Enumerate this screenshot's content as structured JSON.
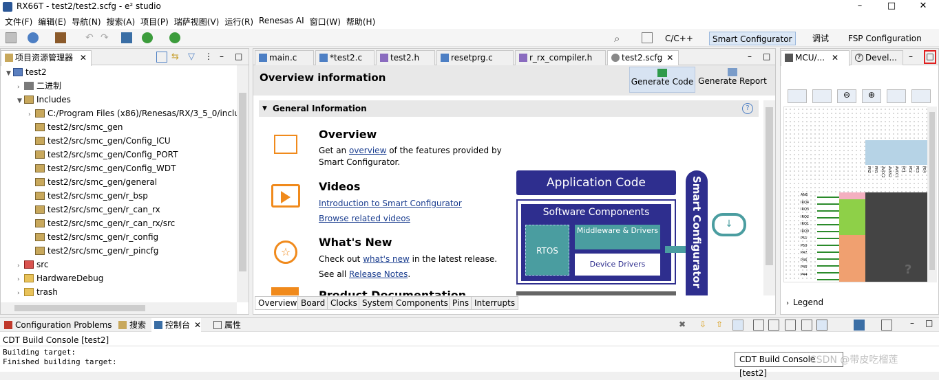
{
  "window": {
    "title": "RX66T - test2/test2.scfg - e² studio",
    "controls": [
      "–",
      "□",
      "✕"
    ]
  },
  "menu": [
    "文件(F)",
    "编辑(E)",
    "导航(N)",
    "搜索(A)",
    "项目(P)",
    "瑞萨视图(V)",
    "运行(R)",
    "Renesas AI",
    "窗口(W)",
    "帮助(H)"
  ],
  "perspectives": [
    "C/C++",
    "Smart Configurator",
    "调试",
    "FSP Configuration"
  ],
  "explorer": {
    "tab": "项目资源管理器",
    "items": [
      {
        "label": "test2",
        "expanded": true
      },
      {
        "label": "二进制",
        "expanded": false
      },
      {
        "label": "Includes",
        "expanded": true
      },
      {
        "label": "C:/Program Files (x86)/Renesas/RX/3_5_0/inclu"
      },
      {
        "label": "test2/src/smc_gen"
      },
      {
        "label": "test2/src/smc_gen/Config_ICU"
      },
      {
        "label": "test2/src/smc_gen/Config_PORT"
      },
      {
        "label": "test2/src/smc_gen/Config_WDT"
      },
      {
        "label": "test2/src/smc_gen/general"
      },
      {
        "label": "test2/src/smc_gen/r_bsp"
      },
      {
        "label": "test2/src/smc_gen/r_can_rx"
      },
      {
        "label": "test2/src/smc_gen/r_can_rx/src"
      },
      {
        "label": "test2/src/smc_gen/r_config"
      },
      {
        "label": "test2/src/smc_gen/r_pincfg"
      },
      {
        "label": "src"
      },
      {
        "label": "HardwareDebug"
      },
      {
        "label": "trash"
      }
    ]
  },
  "editor": {
    "tabs": [
      "main.c",
      "*test2.c",
      "test2.h",
      "resetprg.c",
      "r_rx_compiler.h",
      "test2.scfg"
    ],
    "heading": "Overview information",
    "generate_code": "Generate Code",
    "generate_report": "Generate Report",
    "section": "General Information",
    "overview_title": "Overview",
    "overview_pre": "Get an ",
    "overview_link": "overview",
    "overview_post": " of the features provided by",
    "overview_post2": "Smart Configurator.",
    "videos_title": "Videos",
    "videos_link1": "Introduction to Smart Configurator",
    "videos_link2": "Browse related videos",
    "new_title": "What's New",
    "new_pre": "Check out ",
    "new_link": "what's new",
    "new_post": " in the latest release.",
    "notes_pre": "See all ",
    "notes_link": "Release Notes",
    "notes_post": ".",
    "doc_title": "Product Documentation",
    "diagram": {
      "app_code": "Application Code",
      "sw_components": "Software Components",
      "rtos": "RTOS",
      "middleware": "Middleware & Drivers",
      "device_drivers": "Device Drivers",
      "smart_conf": "Smart Configurator"
    },
    "bottom_tabs": [
      "Overview",
      "Board",
      "Clocks",
      "System",
      "Components",
      "Pins",
      "Interrupts"
    ]
  },
  "right_panel": {
    "tabs": [
      "MCU/...",
      "Devel..."
    ],
    "legend": "Legend",
    "pin_labels_left": [
      "AN6",
      "IRQ4",
      "IRQ3",
      "IRQ2",
      "IRQ1",
      "IRQ0",
      "P51",
      "P50",
      "P47",
      "P46",
      "P45",
      "P44"
    ],
    "pin_labels_top": [
      "PN2",
      "PN1",
      "AVCC2",
      "AVSS2",
      "AVCC1",
      "PE1",
      "PE2",
      "PE3",
      "PE4"
    ]
  },
  "console": {
    "tabs": [
      "Configuration Problems",
      "搜索",
      "控制台",
      "属性"
    ],
    "title": "CDT Build Console [test2]",
    "lines": [
      "Building target:",
      "Finished building target:"
    ],
    "tooltip": "CDT Build Console [test2]",
    "watermark": "CSDN @带皮吃榴莲"
  }
}
